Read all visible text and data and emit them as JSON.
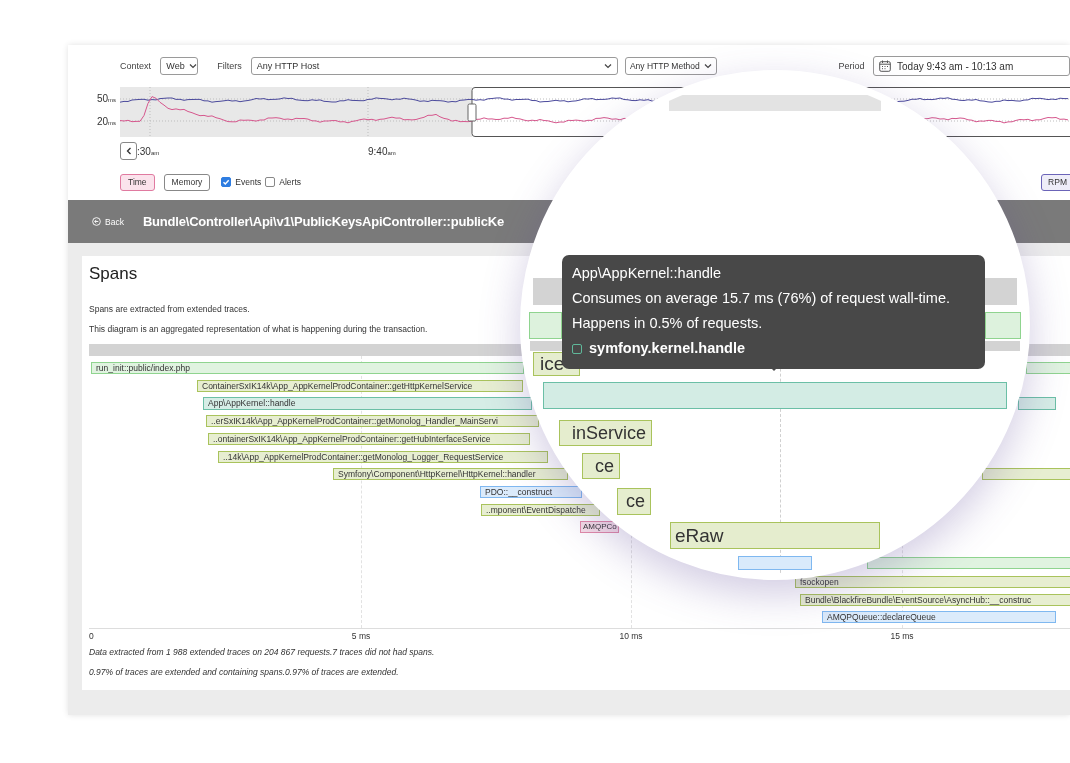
{
  "toolbar": {
    "context_label": "Context",
    "context_value": "Web",
    "filters_label": "Filters",
    "host_filter": "Any HTTP Host",
    "method_filter": "Any HTTP Method",
    "period_label": "Period",
    "period_value": "Today 9:43 am - 10:13 am"
  },
  "graph": {
    "y_labels": [
      "50$_{ms}$",
      "20$_{ms}$"
    ],
    "x_labels": [
      ":30$_{am}$",
      "9:40$_{am}$"
    ]
  },
  "metric_buttons": [
    {
      "label": "Time",
      "selected": true
    },
    {
      "label": "Memory",
      "selected": false
    }
  ],
  "toggles": [
    {
      "label": "Events",
      "checked": true
    },
    {
      "label": "Alerts",
      "checked": false
    }
  ],
  "rpm_button": "RPM",
  "header": {
    "back_label": "Back",
    "title": "Bundle\\Controller\\Api\\v1\\PublicKeysApiController::publicKe"
  },
  "spans": {
    "title": "Spans",
    "notes": [
      "Spans are extracted from extended traces.",
      "This diagram is an aggregated representation of what is happening during the transaction."
    ],
    "rows": [
      {
        "label": "run_init::public/index.php",
        "color": "#8fd48f"
      },
      {
        "label": "ContainerSxIK14k\\App_AppKernelProdContainer::getHttpKernelService",
        "color": "#a9c35c"
      },
      {
        "label": "App\\AppKernel::handle",
        "color": "#6bbfa6"
      },
      {
        "label": "..erSxIK14k\\App_AppKernelProdContainer::getMonolog_Handler_MainServi",
        "color": "#a9c35c"
      },
      {
        "label": "..ontainerSxIK14k\\App_AppKernelProdContainer::getHubInterfaceService",
        "color": "#a9c35c"
      },
      {
        "label": "..14k\\App_AppKernelProdContainer::getMonolog_Logger_RequestService",
        "color": "#a9c35c"
      },
      {
        "label": "Symfony\\Component\\HttpKernel\\HttpKernel::handler",
        "color": "#a9c35c"
      },
      {
        "label": "PDO::__construct",
        "color": "#7fb8f0"
      },
      {
        "label": "..mponent\\EventDispatche",
        "color": "#a9c35c"
      },
      {
        "label": "AMQPCo",
        "color": "#e28aa8"
      },
      {
        "color": "#8fd48f"
      },
      {
        "label": "fsockopen",
        "color": "#a9c35c"
      },
      {
        "label": "Bundle\\BlackfireBundle\\EventSource\\AsyncHub::__construc",
        "color": "#a9c35c"
      },
      {
        "label": "AMQPQueue::declareQueue",
        "color": "#7fb8f0"
      }
    ],
    "axis_labels": [
      "0",
      "5 ms",
      "10 ms",
      "15 ms"
    ],
    "footnotes": [
      "Data extracted from 1 988 extended traces on 204 867 requests.7 traces did not had spans.",
      "0.97% of traces are extended and containing spans.0.97% of traces are extended."
    ]
  },
  "magnifier": {
    "tooltip": {
      "title": "App\\AppKernel::handle",
      "lines": [
        "Consumes on average 15.7 ms (76%) of request wall-time.",
        "Happens in 0.5% of requests."
      ],
      "event": "symfony.kernel.handle"
    },
    "bars": [
      {
        "color": "#8fd48f"
      },
      {
        "label": "ice",
        "color": "#a9c35c"
      },
      {
        "color": "#6bbfa6"
      },
      {
        "label": "inService",
        "color": "#a9c35c"
      },
      {
        "label": "ce",
        "color": "#a9c35c"
      },
      {
        "label": "ce",
        "color": "#a9c35c"
      },
      {
        "label": "eRaw",
        "color": "#a9c35c"
      },
      {
        "color": "#7fb8f0"
      }
    ]
  }
}
